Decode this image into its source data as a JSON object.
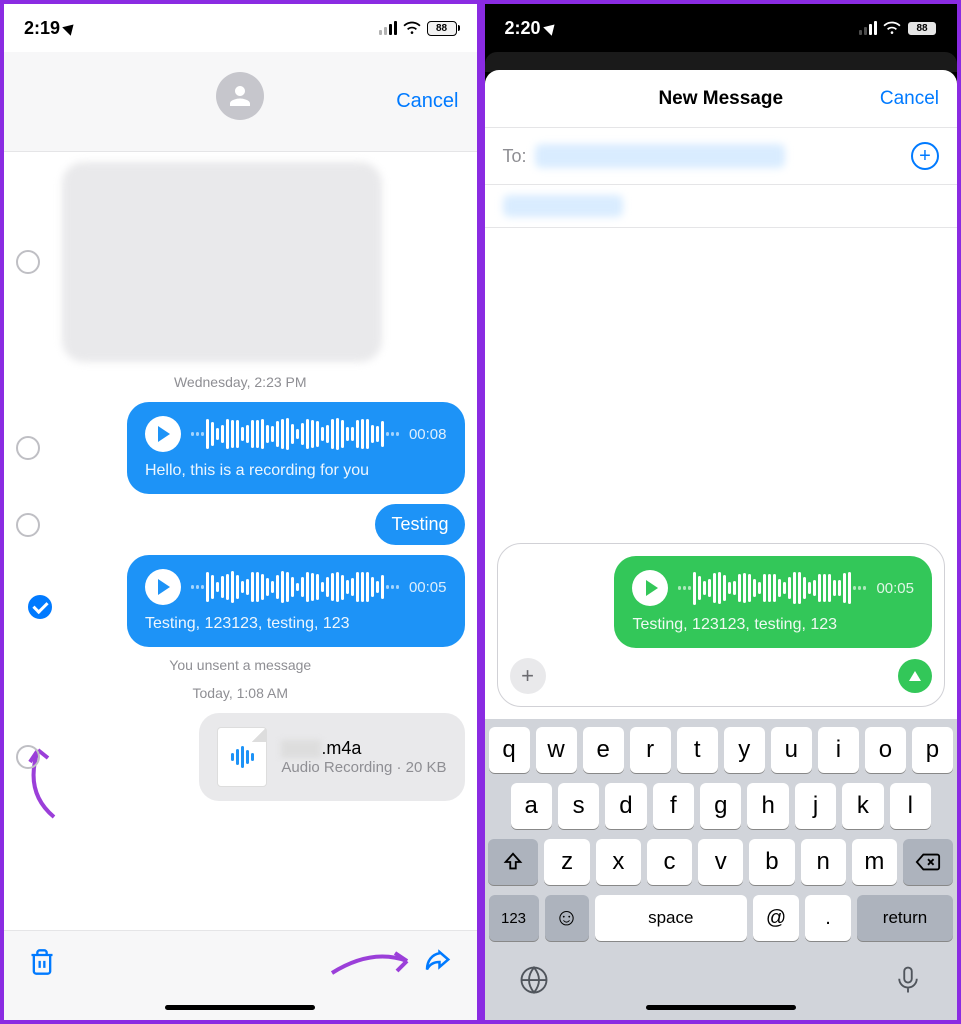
{
  "left": {
    "status": {
      "time": "2:19",
      "battery": "88"
    },
    "header": {
      "cancel": "Cancel"
    },
    "ts1": "Wednesday, 2:23 PM",
    "audio1": {
      "duration": "00:08",
      "caption": "Hello, this is a recording for you"
    },
    "text1": "Testing",
    "audio2": {
      "duration": "00:05",
      "caption": "Testing, 123123, testing, 123"
    },
    "unsent": "You unsent a message",
    "ts2": "Today, 1:08 AM",
    "file": {
      "name": ".m4a",
      "meta": "Audio Recording · 20 KB"
    }
  },
  "right": {
    "status": {
      "time": "2:20",
      "battery": "88"
    },
    "sheet": {
      "title": "New Message",
      "cancel": "Cancel",
      "to": "To:"
    },
    "audio": {
      "duration": "00:05",
      "caption": "Testing, 123123, testing, 123"
    },
    "keyboard": {
      "row1": [
        "q",
        "w",
        "e",
        "r",
        "t",
        "y",
        "u",
        "i",
        "o",
        "p"
      ],
      "row2": [
        "a",
        "s",
        "d",
        "f",
        "g",
        "h",
        "j",
        "k",
        "l"
      ],
      "row3": [
        "z",
        "x",
        "c",
        "v",
        "b",
        "n",
        "m"
      ],
      "numKey": "123",
      "space": "space",
      "at": "@",
      "dot": ".",
      "return": "return"
    }
  }
}
